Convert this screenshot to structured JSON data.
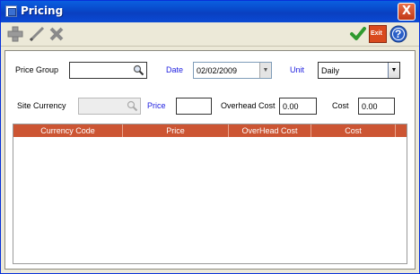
{
  "window": {
    "title": "Pricing",
    "close_label": "X"
  },
  "toolbar": {
    "icons": [
      "add-icon",
      "edit-icon",
      "delete-icon",
      "save-icon",
      "exit-icon",
      "help-icon"
    ],
    "exit_label": "Exit",
    "help_label": "?"
  },
  "form": {
    "price_group_label": "Price Group",
    "price_group_value": "",
    "date_label": "Date",
    "date_value": "02/02/2009",
    "unit_label": "Unit",
    "unit_value": "Daily",
    "site_currency_label": "Site Currency",
    "site_currency_value": "",
    "price_label": "Price",
    "price_value": "",
    "overhead_cost_label": "Overhead Cost",
    "overhead_cost_value": "0.00",
    "cost_label": "Cost",
    "cost_value": "0.00"
  },
  "grid": {
    "columns": [
      "Currency Code",
      "Price",
      "OverHead Cost",
      "Cost"
    ],
    "rows": []
  },
  "colors": {
    "title_bar": "#0a4fd0",
    "grid_header": "#cc5533",
    "accent_label": "#2020e0"
  }
}
